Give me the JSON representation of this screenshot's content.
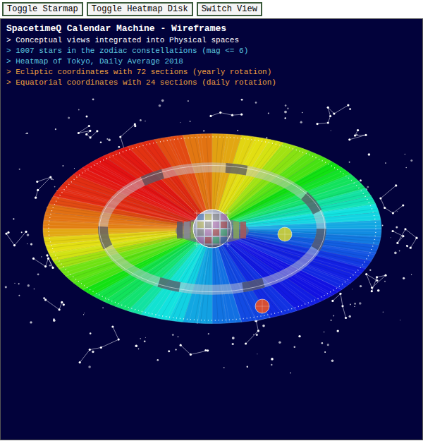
{
  "buttons": [
    "Toggle Starmap",
    "Toggle Heatmap Disk",
    "Switch View"
  ],
  "title": "SpacetimeQ Calendar Machine - Wireframes",
  "lines": [
    {
      "text": "> Conceptual views integrated into Physical spaces",
      "color": "#ffffff"
    },
    {
      "text": "> 1007 stars in the zodiac constellations (mag <= 6)",
      "color": "#5cc8e0"
    },
    {
      "text": "> Heatmap of Tokyo, Daily Average 2018",
      "color": "#5cc8e0"
    },
    {
      "text": "> Ecliptic coordinates with 72 sections (yearly rotation)",
      "color": "#f0a040"
    },
    {
      "text": "> Equatorial coordinates with 24 sections (daily rotation)",
      "color": "#f0a040"
    }
  ],
  "heatmap": {
    "values": [
      8.4,
      7.9,
      7.1,
      6.8,
      6.1,
      5.4,
      5.4,
      5.6,
      5.0,
      5.0,
      5.3,
      5.2,
      5.9,
      5.7,
      6.4,
      6.5,
      7.6,
      7.7,
      8.9,
      9.1,
      10.3,
      10.8,
      11.2,
      12.6,
      13.9,
      14.5,
      15.1,
      16.5,
      17.9,
      18.5,
      19.1,
      20.4,
      21.8,
      22.3,
      22.7,
      23.9,
      25.0,
      25.3,
      25.4,
      26.5,
      27.3,
      27.3,
      27.2,
      27.8,
      28.0,
      28.0,
      27.6,
      27.8,
      27.1,
      27.3,
      26.4,
      26.5,
      25.2,
      25.3,
      24.1,
      23.9,
      22.6,
      22.3,
      21.9,
      20.4,
      19.8,
      18.5,
      17.9,
      16.5,
      15.9,
      14.5,
      13.9,
      12.6,
      12.0,
      10.8,
      10.4,
      9.1
    ]
  },
  "planets": [
    {
      "color": "#c8cc3c"
    },
    {
      "color": "#e0502c"
    }
  ]
}
